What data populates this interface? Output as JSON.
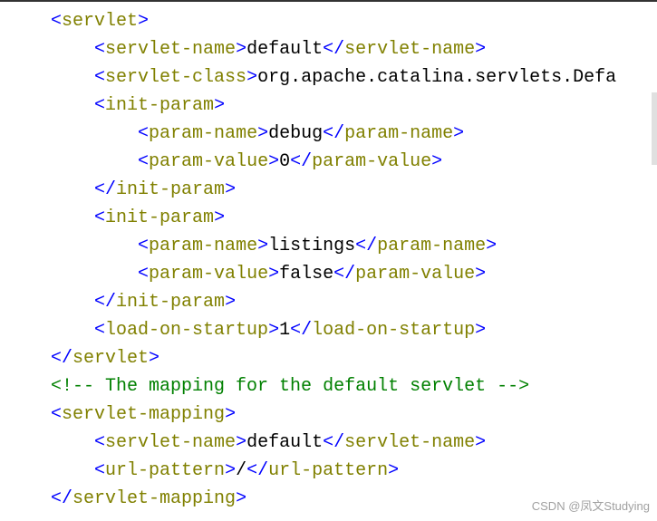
{
  "code": {
    "lines": [
      {
        "indent": 1,
        "parts": [
          {
            "t": "br",
            "v": "<"
          },
          {
            "t": "tag",
            "v": "servlet"
          },
          {
            "t": "br",
            "v": ">"
          }
        ]
      },
      {
        "indent": 2,
        "parts": [
          {
            "t": "br",
            "v": "<"
          },
          {
            "t": "tag",
            "v": "servlet-name"
          },
          {
            "t": "br",
            "v": ">"
          },
          {
            "t": "txt",
            "v": "default"
          },
          {
            "t": "br",
            "v": "</"
          },
          {
            "t": "tag",
            "v": "servlet-name"
          },
          {
            "t": "br",
            "v": ">"
          }
        ]
      },
      {
        "indent": 2,
        "parts": [
          {
            "t": "br",
            "v": "<"
          },
          {
            "t": "tag",
            "v": "servlet-class"
          },
          {
            "t": "br",
            "v": ">"
          },
          {
            "t": "txt",
            "v": "org.apache.catalina.servlets.Defa"
          }
        ]
      },
      {
        "indent": 2,
        "parts": [
          {
            "t": "br",
            "v": "<"
          },
          {
            "t": "tag",
            "v": "init-param"
          },
          {
            "t": "br",
            "v": ">"
          }
        ]
      },
      {
        "indent": 3,
        "parts": [
          {
            "t": "br",
            "v": "<"
          },
          {
            "t": "tag",
            "v": "param-name"
          },
          {
            "t": "br",
            "v": ">"
          },
          {
            "t": "txt",
            "v": "debug"
          },
          {
            "t": "br",
            "v": "</"
          },
          {
            "t": "tag",
            "v": "param-name"
          },
          {
            "t": "br",
            "v": ">"
          }
        ]
      },
      {
        "indent": 3,
        "parts": [
          {
            "t": "br",
            "v": "<"
          },
          {
            "t": "tag",
            "v": "param-value"
          },
          {
            "t": "br",
            "v": ">"
          },
          {
            "t": "txt",
            "v": "0"
          },
          {
            "t": "br",
            "v": "</"
          },
          {
            "t": "tag",
            "v": "param-value"
          },
          {
            "t": "br",
            "v": ">"
          }
        ]
      },
      {
        "indent": 2,
        "parts": [
          {
            "t": "br",
            "v": "</"
          },
          {
            "t": "tag",
            "v": "init-param"
          },
          {
            "t": "br",
            "v": ">"
          }
        ]
      },
      {
        "indent": 2,
        "parts": [
          {
            "t": "br",
            "v": "<"
          },
          {
            "t": "tag",
            "v": "init-param"
          },
          {
            "t": "br",
            "v": ">"
          }
        ]
      },
      {
        "indent": 3,
        "parts": [
          {
            "t": "br",
            "v": "<"
          },
          {
            "t": "tag",
            "v": "param-name"
          },
          {
            "t": "br",
            "v": ">"
          },
          {
            "t": "txt",
            "v": "listings"
          },
          {
            "t": "br",
            "v": "</"
          },
          {
            "t": "tag",
            "v": "param-name"
          },
          {
            "t": "br",
            "v": ">"
          }
        ]
      },
      {
        "indent": 3,
        "parts": [
          {
            "t": "br",
            "v": "<"
          },
          {
            "t": "tag",
            "v": "param-value"
          },
          {
            "t": "br",
            "v": ">"
          },
          {
            "t": "txt",
            "v": "false"
          },
          {
            "t": "br",
            "v": "</"
          },
          {
            "t": "tag",
            "v": "param-value"
          },
          {
            "t": "br",
            "v": ">"
          }
        ]
      },
      {
        "indent": 2,
        "parts": [
          {
            "t": "br",
            "v": "</"
          },
          {
            "t": "tag",
            "v": "init-param"
          },
          {
            "t": "br",
            "v": ">"
          }
        ]
      },
      {
        "indent": 2,
        "parts": [
          {
            "t": "br",
            "v": "<"
          },
          {
            "t": "tag",
            "v": "load-on-startup"
          },
          {
            "t": "br",
            "v": ">"
          },
          {
            "t": "txt",
            "v": "1"
          },
          {
            "t": "br",
            "v": "</"
          },
          {
            "t": "tag",
            "v": "load-on-startup"
          },
          {
            "t": "br",
            "v": ">"
          }
        ]
      },
      {
        "indent": 1,
        "parts": [
          {
            "t": "br",
            "v": "</"
          },
          {
            "t": "tag",
            "v": "servlet"
          },
          {
            "t": "br",
            "v": ">"
          }
        ]
      },
      {
        "indent": 1,
        "parts": [
          {
            "t": "cm",
            "v": "<!-- The mapping for the default servlet -->"
          }
        ]
      },
      {
        "indent": 1,
        "parts": [
          {
            "t": "br",
            "v": "<"
          },
          {
            "t": "tag",
            "v": "servlet-mapping"
          },
          {
            "t": "br",
            "v": ">"
          }
        ]
      },
      {
        "indent": 2,
        "parts": [
          {
            "t": "br",
            "v": "<"
          },
          {
            "t": "tag",
            "v": "servlet-name"
          },
          {
            "t": "br",
            "v": ">"
          },
          {
            "t": "txt",
            "v": "default"
          },
          {
            "t": "br",
            "v": "</"
          },
          {
            "t": "tag",
            "v": "servlet-name"
          },
          {
            "t": "br",
            "v": ">"
          }
        ]
      },
      {
        "indent": 2,
        "parts": [
          {
            "t": "br",
            "v": "<"
          },
          {
            "t": "tag",
            "v": "url-pattern"
          },
          {
            "t": "br",
            "v": ">"
          },
          {
            "t": "txt",
            "v": "/"
          },
          {
            "t": "br",
            "v": "</"
          },
          {
            "t": "tag",
            "v": "url-pattern"
          },
          {
            "t": "br",
            "v": ">"
          }
        ]
      },
      {
        "indent": 1,
        "parts": [
          {
            "t": "br",
            "v": "</"
          },
          {
            "t": "tag",
            "v": "servlet-mapping"
          },
          {
            "t": "br",
            "v": ">"
          }
        ]
      }
    ]
  },
  "watermark": "CSDN @凤文Studying"
}
